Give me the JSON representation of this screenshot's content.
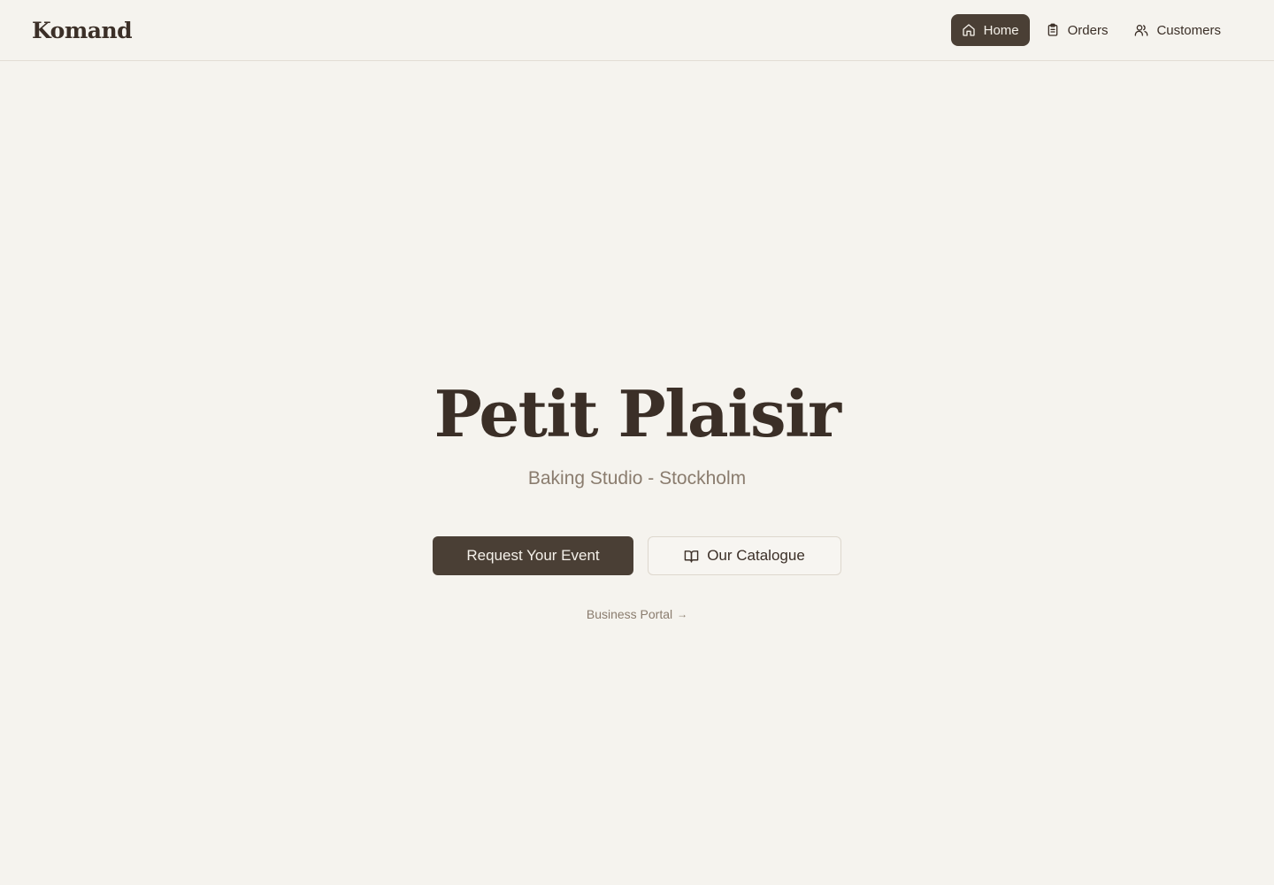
{
  "header": {
    "brand": "Komand",
    "nav": [
      {
        "label": "Home",
        "icon": "home-icon",
        "active": true
      },
      {
        "label": "Orders",
        "icon": "clipboard-icon",
        "active": false
      },
      {
        "label": "Customers",
        "icon": "users-icon",
        "active": false
      }
    ]
  },
  "hero": {
    "title": "Petit Plaisir",
    "subtitle": "Baking Studio - Stockholm",
    "primary_cta": "Request Your Event",
    "secondary_cta": "Our Catalogue",
    "secondary_cta_icon": "book-open-icon",
    "portal_link": "Business Portal",
    "portal_arrow": "→"
  },
  "colors": {
    "background": "#f5f3ee",
    "accent": "#4a3f35",
    "text": "#3b2f27",
    "muted": "#8a7c6e"
  }
}
